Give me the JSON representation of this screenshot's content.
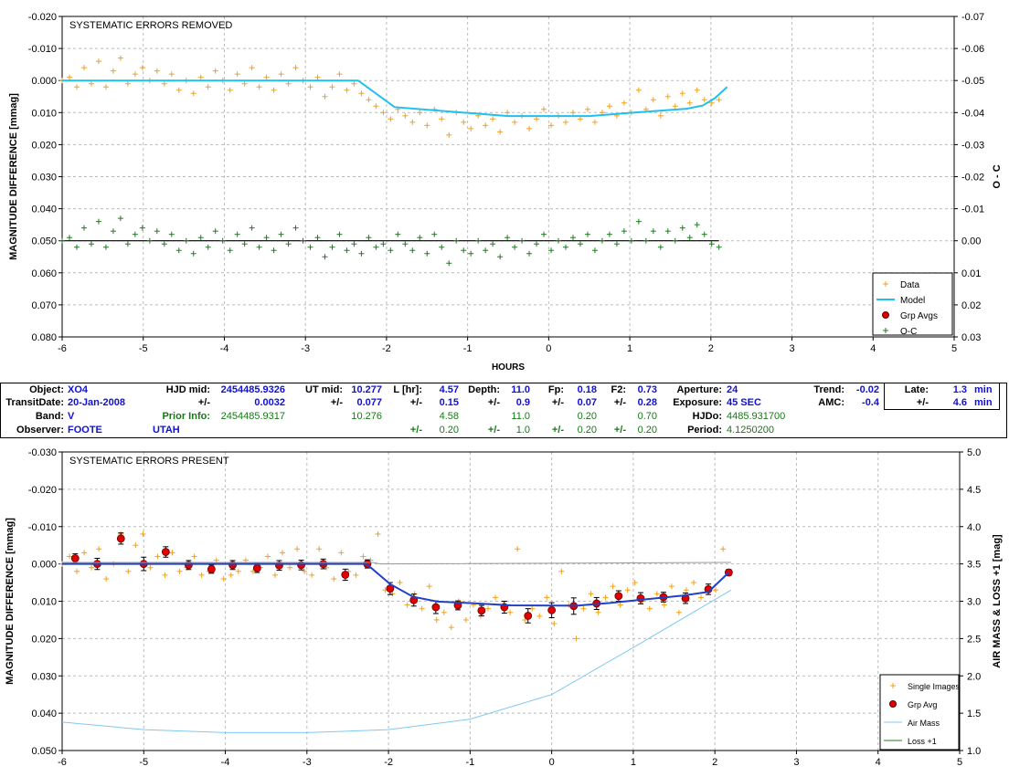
{
  "colors": {
    "data": "#f0a020",
    "model_top": "#1ec0f0",
    "model_bottom": "#2040c8",
    "grp_avg": "#e00000",
    "oc": "#207a20",
    "airmass": "#80c8f0",
    "loss": "#208020",
    "prior_info": "#187818",
    "fit_values": "#1010d8"
  },
  "chart_data": [
    {
      "type": "scatter",
      "title": "SYSTEMATIC ERRORS REMOVED",
      "xlabel": "HOURS",
      "ylabel": "MAGNITUDE DIFFERENCE [mmag]",
      "y2label": "O - C",
      "xlim": [
        -6,
        5
      ],
      "ylim": [
        -0.02,
        0.08
      ],
      "y_inverted": true,
      "y2lim": [
        -0.07,
        0.03
      ],
      "y2_inverted": true,
      "x_ticks": [
        "-6",
        "-5",
        "-4",
        "-3",
        "-2",
        "-1",
        "0",
        "1",
        "2",
        "3",
        "4",
        "5"
      ],
      "y_ticks": [
        "-0.020",
        "-0.010",
        "0.000",
        "0.010",
        "0.020",
        "0.030",
        "0.040",
        "0.050",
        "0.060",
        "0.070",
        "0.080"
      ],
      "y2_ticks": [
        "-0.07",
        "-0.06",
        "-0.05",
        "-0.04",
        "-0.03",
        "-0.02",
        "-0.01",
        "0.00",
        "0.01",
        "0.02",
        "0.03"
      ],
      "grid": true,
      "legend_position": "bottom-right",
      "legend": [
        "Data",
        "Model",
        "Grp Avgs",
        "O-C"
      ],
      "series": [
        {
          "name": "Data",
          "style": "cross",
          "x": [
            -6.0,
            -5.91,
            -5.82,
            -5.73,
            -5.64,
            -5.55,
            -5.46,
            -5.37,
            -5.28,
            -5.19,
            -5.1,
            -5.01,
            -4.92,
            -4.83,
            -4.74,
            -4.65,
            -4.56,
            -4.47,
            -4.38,
            -4.29,
            -4.2,
            -4.11,
            -4.02,
            -3.93,
            -3.84,
            -3.75,
            -3.66,
            -3.57,
            -3.48,
            -3.39,
            -3.3,
            -3.21,
            -3.12,
            -3.03,
            -2.94,
            -2.85,
            -2.76,
            -2.67,
            -2.58,
            -2.49,
            -2.4,
            -2.31,
            -2.22,
            -2.13,
            -2.04,
            -1.95,
            -1.86,
            -1.77,
            -1.68,
            -1.59,
            -1.5,
            -1.41,
            -1.32,
            -1.23,
            -1.14,
            -1.05,
            -0.96,
            -0.87,
            -0.78,
            -0.69,
            -0.6,
            -0.51,
            -0.42,
            -0.33,
            -0.24,
            -0.15,
            -0.06,
            0.03,
            0.12,
            0.21,
            0.3,
            0.39,
            0.48,
            0.57,
            0.66,
            0.75,
            0.84,
            0.93,
            1.02,
            1.11,
            1.2,
            1.29,
            1.38,
            1.47,
            1.56,
            1.65,
            1.74,
            1.83,
            1.92,
            2.01,
            2.1
          ],
          "y": [
            0.0,
            -0.001,
            0.002,
            -0.004,
            0.001,
            -0.006,
            0.002,
            -0.003,
            -0.007,
            0.001,
            -0.002,
            -0.004,
            0.0,
            -0.003,
            0.001,
            -0.002,
            0.003,
            0.0,
            0.004,
            -0.001,
            0.002,
            -0.003,
            0.0,
            0.003,
            -0.002,
            0.001,
            -0.004,
            0.002,
            -0.001,
            0.003,
            -0.002,
            0.001,
            -0.004,
            0.0,
            0.002,
            -0.001,
            0.005,
            0.002,
            -0.002,
            0.003,
            0.001,
            0.004,
            0.006,
            0.008,
            0.01,
            0.012,
            0.009,
            0.011,
            0.013,
            0.01,
            0.014,
            0.009,
            0.012,
            0.017,
            0.01,
            0.013,
            0.015,
            0.011,
            0.014,
            0.012,
            0.016,
            0.01,
            0.013,
            0.011,
            0.015,
            0.012,
            0.009,
            0.014,
            0.011,
            0.013,
            0.01,
            0.012,
            0.009,
            0.013,
            0.01,
            0.008,
            0.011,
            0.007,
            0.01,
            0.003,
            0.009,
            0.006,
            0.011,
            0.005,
            0.008,
            0.004,
            0.007,
            0.003,
            0.006,
            0.007,
            0.006
          ]
        },
        {
          "name": "Model",
          "style": "line",
          "x": [
            -6.0,
            -2.35,
            -1.9,
            -1.0,
            -0.5,
            0.5,
            1.0,
            1.7,
            1.9,
            2.05,
            2.2
          ],
          "y": [
            0.0,
            0.0,
            0.0083,
            0.0101,
            0.0111,
            0.0111,
            0.0101,
            0.0088,
            0.0078,
            0.0055,
            0.002
          ]
        },
        {
          "name": "O-C",
          "style": "cross",
          "x": [
            -6.0,
            -5.91,
            -5.82,
            -5.73,
            -5.64,
            -5.55,
            -5.46,
            -5.37,
            -5.28,
            -5.19,
            -5.1,
            -5.01,
            -4.92,
            -4.83,
            -4.74,
            -4.65,
            -4.56,
            -4.47,
            -4.38,
            -4.29,
            -4.2,
            -4.11,
            -4.02,
            -3.93,
            -3.84,
            -3.75,
            -3.66,
            -3.57,
            -3.48,
            -3.39,
            -3.3,
            -3.21,
            -3.12,
            -3.03,
            -2.94,
            -2.85,
            -2.76,
            -2.67,
            -2.58,
            -2.49,
            -2.4,
            -2.31,
            -2.22,
            -2.13,
            -2.04,
            -1.95,
            -1.86,
            -1.77,
            -1.68,
            -1.59,
            -1.5,
            -1.41,
            -1.32,
            -1.23,
            -1.14,
            -1.05,
            -0.96,
            -0.87,
            -0.78,
            -0.69,
            -0.6,
            -0.51,
            -0.42,
            -0.33,
            -0.24,
            -0.15,
            -0.06,
            0.03,
            0.12,
            0.21,
            0.3,
            0.39,
            0.48,
            0.57,
            0.66,
            0.75,
            0.84,
            0.93,
            1.02,
            1.11,
            1.2,
            1.29,
            1.38,
            1.47,
            1.56,
            1.65,
            1.74,
            1.83,
            1.92,
            2.01,
            2.1
          ],
          "y": [
            0.0,
            -0.001,
            0.002,
            -0.004,
            0.001,
            -0.006,
            0.002,
            -0.003,
            -0.007,
            0.001,
            -0.002,
            -0.004,
            0.0,
            -0.003,
            0.001,
            -0.002,
            0.003,
            0.0,
            0.004,
            -0.001,
            0.002,
            -0.003,
            0.0,
            0.003,
            -0.002,
            0.001,
            -0.004,
            0.002,
            -0.001,
            0.003,
            -0.002,
            0.001,
            -0.004,
            0.0,
            0.002,
            -0.001,
            0.005,
            0.002,
            -0.002,
            0.003,
            0.001,
            0.004,
            -0.001,
            0.002,
            0.001,
            0.003,
            -0.002,
            0.001,
            0.003,
            -0.001,
            0.004,
            -0.002,
            0.002,
            0.007,
            0.0,
            0.003,
            0.004,
            0.0,
            0.003,
            0.001,
            0.005,
            -0.001,
            0.002,
            0.0,
            0.004,
            0.001,
            -0.002,
            0.003,
            0.0,
            0.002,
            -0.001,
            0.001,
            -0.002,
            0.003,
            0.0,
            -0.002,
            0.001,
            -0.003,
            0.0,
            -0.006,
            0.0,
            -0.003,
            0.002,
            -0.003,
            0.0,
            -0.004,
            -0.001,
            -0.005,
            -0.002,
            0.001,
            0.002
          ]
        }
      ]
    },
    {
      "type": "scatter",
      "title": "SYSTEMATIC ERRORS PRESENT",
      "xlabel": "",
      "ylabel": "MAGNITUDE DIFFERENCE [mmag]",
      "y2label": "AIR MASS & LOSS +1 [mag]",
      "xlim": [
        -6,
        5
      ],
      "ylim": [
        -0.03,
        0.05
      ],
      "y_inverted": true,
      "y2lim": [
        1.0,
        5.0
      ],
      "x_ticks": [
        "-6",
        "-5",
        "-4",
        "-3",
        "-2",
        "-1",
        "0",
        "1",
        "2",
        "3",
        "4",
        "5"
      ],
      "y_ticks": [
        "-0.030",
        "-0.020",
        "-0.010",
        "0.000",
        "0.010",
        "0.020",
        "0.030",
        "0.040",
        "0.050"
      ],
      "y2_ticks": [
        "1.0",
        "1.5",
        "2.0",
        "2.5",
        "3.0",
        "3.5",
        "4.0",
        "4.5",
        "5.0"
      ],
      "grid": true,
      "legend_position": "bottom-right",
      "legend": [
        "Single Images",
        "Grp Avg",
        "Air Mass",
        "Loss +1"
      ],
      "series": [
        {
          "name": "Single Images",
          "style": "cross",
          "x": [
            -6.0,
            -5.91,
            -5.82,
            -5.73,
            -5.64,
            -5.55,
            -5.46,
            -5.37,
            -5.28,
            -5.19,
            -5.1,
            -5.01,
            -4.92,
            -4.83,
            -4.74,
            -4.65,
            -4.56,
            -4.47,
            -4.38,
            -4.29,
            -4.2,
            -4.11,
            -4.02,
            -3.93,
            -3.84,
            -3.75,
            -3.66,
            -3.57,
            -3.48,
            -3.39,
            -3.3,
            -3.21,
            -3.12,
            -3.03,
            -2.94,
            -2.85,
            -2.76,
            -2.67,
            -2.58,
            -2.49,
            -2.4,
            -2.31,
            -2.22,
            -2.13,
            -2.04,
            -1.95,
            -1.86,
            -1.77,
            -1.68,
            -1.59,
            -1.5,
            -1.41,
            -1.32,
            -1.23,
            -1.14,
            -1.05,
            -0.96,
            -0.87,
            -0.78,
            -0.69,
            -0.6,
            -0.51,
            -0.42,
            -0.33,
            -0.24,
            -0.15,
            -0.06,
            0.03,
            0.12,
            0.21,
            0.3,
            0.39,
            0.48,
            0.57,
            0.66,
            0.75,
            0.84,
            0.93,
            1.02,
            1.11,
            1.2,
            1.29,
            1.38,
            1.47,
            1.56,
            1.65,
            1.74,
            1.83,
            1.92,
            2.01,
            2.1
          ],
          "y": [
            0.0,
            -0.002,
            0.002,
            -0.003,
            0.001,
            -0.004,
            0.004,
            0.0,
            -0.008,
            0.002,
            -0.005,
            -0.008,
            0.001,
            -0.002,
            0.003,
            -0.003,
            0.002,
            0.001,
            -0.002,
            0.003,
            0.002,
            -0.001,
            0.004,
            0.003,
            0.002,
            -0.001,
            0.002,
            0.001,
            -0.002,
            0.003,
            -0.003,
            0.001,
            -0.004,
            0.002,
            0.003,
            -0.004,
            0.001,
            0.004,
            -0.003,
            0.002,
            0.003,
            -0.002,
            -0.001,
            -0.008,
            0.007,
            0.008,
            0.005,
            0.011,
            0.008,
            0.012,
            0.006,
            0.015,
            0.013,
            0.017,
            0.01,
            0.015,
            0.011,
            0.014,
            0.012,
            0.009,
            0.011,
            0.013,
            -0.004,
            0.015,
            0.012,
            0.014,
            0.009,
            0.016,
            0.002,
            0.011,
            0.02,
            0.012,
            0.008,
            0.013,
            0.009,
            0.006,
            0.011,
            0.007,
            0.005,
            0.01,
            0.012,
            0.008,
            0.011,
            0.006,
            0.013,
            0.007,
            0.005,
            0.009,
            0.006,
            0.007,
            -0.004
          ]
        },
        {
          "name": "Grp Avg",
          "style": "dot-errorbar",
          "x": [
            -5.84,
            -5.57,
            -5.28,
            -5.0,
            -4.73,
            -4.45,
            -4.17,
            -3.91,
            -3.61,
            -3.34,
            -3.07,
            -2.8,
            -2.53,
            -2.26,
            -1.98,
            -1.69,
            -1.42,
            -1.15,
            -0.86,
            -0.58,
            -0.29,
            0.0,
            0.27,
            0.55,
            0.82,
            1.09,
            1.37,
            1.64,
            1.92,
            2.17
          ],
          "y": [
            -0.0015,
            0.0,
            -0.0068,
            0.0,
            -0.0032,
            0.0003,
            0.0014,
            0.0003,
            0.0011,
            0.0004,
            0.0003,
            0.0,
            0.0029,
            0.0,
            0.0066,
            0.0097,
            0.0116,
            0.0111,
            0.0125,
            0.0116,
            0.0139,
            0.0124,
            0.0113,
            0.0106,
            0.0086,
            0.0092,
            0.0089,
            0.0092,
            0.0068,
            0.0023
          ],
          "err": [
            0.0012,
            0.0015,
            0.0015,
            0.0018,
            0.0014,
            0.0012,
            0.0011,
            0.0012,
            0.0012,
            0.0013,
            0.0013,
            0.0013,
            0.0015,
            0.0011,
            0.0016,
            0.0016,
            0.0017,
            0.0012,
            0.0014,
            0.0016,
            0.0019,
            0.002,
            0.0022,
            0.0016,
            0.0014,
            0.0015,
            0.0013,
            0.0014,
            0.0014,
            0.0008
          ]
        },
        {
          "name": "Model",
          "style": "line",
          "x": [
            -6.0,
            -2.27,
            -1.98,
            -1.7,
            -1.4,
            -1.0,
            -0.5,
            0.3,
            0.7,
            1.1,
            1.6,
            1.92,
            2.17
          ],
          "y": [
            0.0,
            0.0,
            0.0054,
            0.0088,
            0.0101,
            0.0105,
            0.0111,
            0.0112,
            0.0105,
            0.0096,
            0.0085,
            0.0075,
            0.0023
          ]
        },
        {
          "name": "Air Mass",
          "style": "line",
          "y_axis": "right",
          "x": [
            -6.0,
            -5.0,
            -4.0,
            -3.0,
            -2.0,
            -1.0,
            0.0,
            1.0,
            2.2
          ],
          "y": [
            1.38,
            1.28,
            1.24,
            1.24,
            1.28,
            1.42,
            1.75,
            2.38,
            3.15
          ]
        },
        {
          "name": "Loss +1",
          "style": "line",
          "y_axis": "right",
          "x": [
            -6.0,
            -2.2,
            -2.1,
            2.2
          ],
          "y": [
            3.52,
            3.52,
            3.5,
            3.52
          ]
        }
      ]
    }
  ],
  "info": {
    "object_label": "Object:",
    "object_value": "XO4",
    "transitdate_label": "TransitDate:",
    "transitdate_value": "20-Jan-2008",
    "band_label": "Band:",
    "band_value": "V",
    "observer_label": "Observer:",
    "observer_value": "FOOTE",
    "location": "UTAH",
    "hjd_mid_label": "HJD mid:",
    "hjd_mid_value": "2454485.9326",
    "hjd_err_label": "+/-",
    "hjd_err_value": "0.0032",
    "prior_info_label": "Prior Info:",
    "hjd_prior": "2454485.9317",
    "ut_mid_label": "UT mid:",
    "ut_mid_value": "10.277",
    "ut_err_label": "+/-",
    "ut_err_value": "0.077",
    "ut_prior": "10.276",
    "l_label": "L [hr]:",
    "l_value": "4.57",
    "l_err_label": "+/-",
    "l_err": "0.15",
    "l_prior": "4.58",
    "l_prior_err_label": "+/-",
    "l_prior_err": "0.20",
    "depth_label": "Depth:",
    "depth_value": "11.0",
    "depth_err_label": "+/-",
    "depth_err": "0.9",
    "depth_prior": "11.0",
    "depth_prior_err_label": "+/-",
    "depth_prior_err": "1.0",
    "fp_label": "Fp:",
    "fp_value": "0.18",
    "fp_err_label": "+/-",
    "fp_err": "0.07",
    "fp_prior": "0.20",
    "fp_prior_err_label": "+/-",
    "fp_prior_err": "0.20",
    "f2_label": "F2:",
    "f2_value": "0.73",
    "f2_err_label": "+/-",
    "f2_err": "0.28",
    "f2_prior": "0.70",
    "f2_prior_err_label": "+/-",
    "f2_prior_err": "0.20",
    "aperture_label": "Aperture:",
    "aperture_value": "24",
    "exposure_label": "Exposure:",
    "exposure_value": "45 SEC",
    "hjdo_label": "HJDo:",
    "hjdo_value": "4485.931700",
    "period_label": "Period:",
    "period_value": "4.1250200",
    "trend_label": "Trend:",
    "trend_value": "-0.02",
    "amc_label": "AMC:",
    "amc_value": "-0.4",
    "late_label": "Late:",
    "late_value": "1.3",
    "late_unit": "min",
    "late_err_label": "+/-",
    "late_err": "4.6",
    "late_err_unit": "min"
  }
}
